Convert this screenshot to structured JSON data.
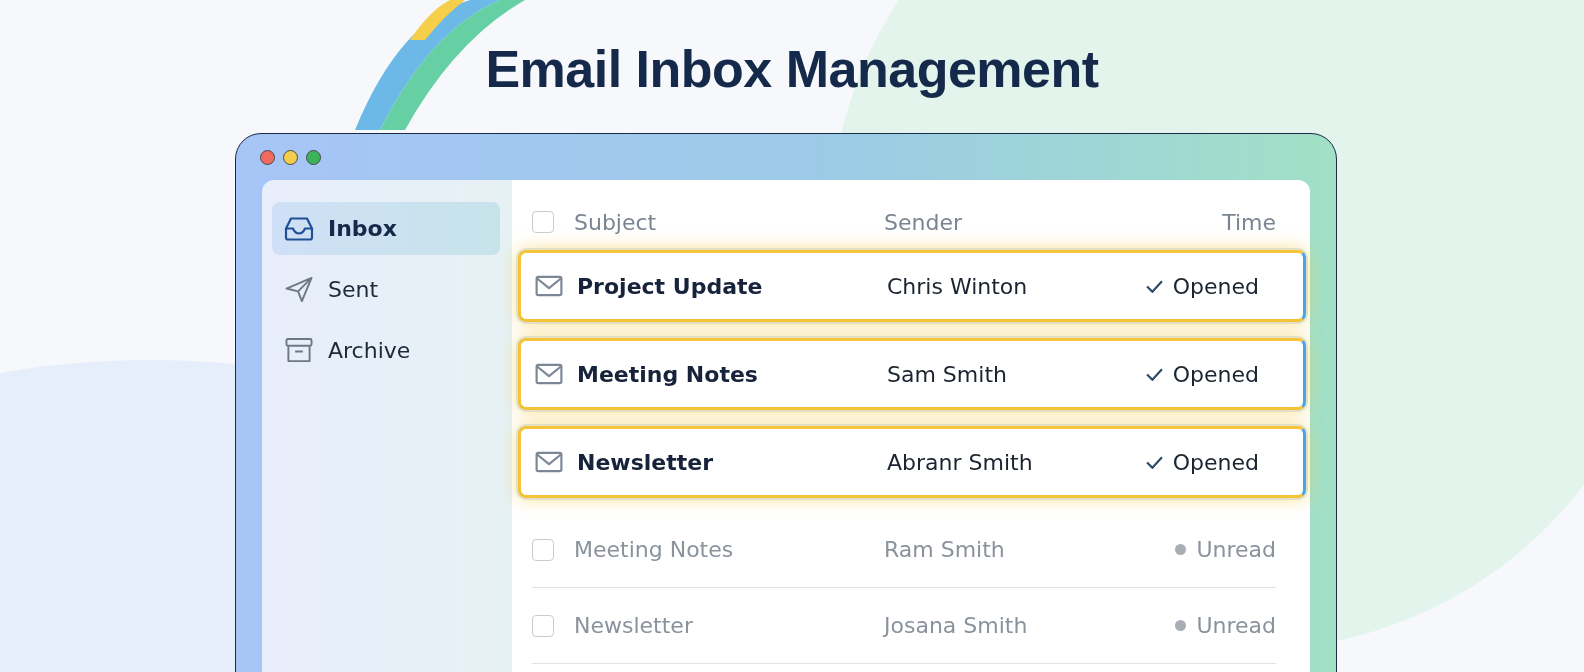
{
  "headline": "Email Inbox Management",
  "sidebar": {
    "items": [
      {
        "label": "Inbox",
        "selected": true
      },
      {
        "label": "Sent",
        "selected": false
      },
      {
        "label": "Archive",
        "selected": false
      }
    ]
  },
  "table": {
    "columns": [
      "Subject",
      "Sender",
      "Time"
    ],
    "select_all_checked": false,
    "rows": [
      {
        "subject": "Project Update",
        "sender": "Chris Winton",
        "status": "Opened",
        "read": true,
        "highlighted": true
      },
      {
        "subject": "Meeting Notes",
        "sender": "Sam Smith",
        "status": "Opened",
        "read": true,
        "highlighted": true
      },
      {
        "subject": "Newsletter",
        "sender": "Abranr Smith",
        "status": "Opened",
        "read": true,
        "highlighted": true
      },
      {
        "subject": "Meeting Notes",
        "sender": "Ram Smith",
        "status": "Unread",
        "read": false,
        "highlighted": false,
        "checked": false
      },
      {
        "subject": "Newsletter",
        "sender": "Josana Smith",
        "status": "Unread",
        "read": false,
        "highlighted": false,
        "checked": false
      }
    ]
  }
}
